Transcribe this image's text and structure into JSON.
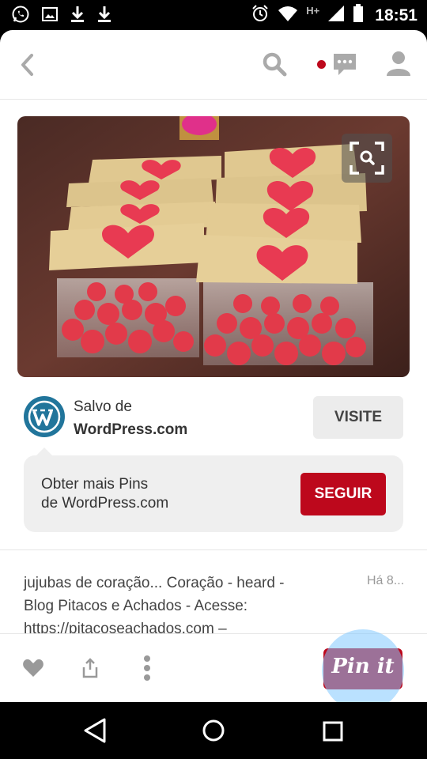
{
  "status_bar": {
    "time": "18:51",
    "network_type": "H+",
    "notification_icons": [
      "whatsapp-icon",
      "image-icon",
      "download-icon",
      "download-icon"
    ],
    "system_icons": [
      "alarm-icon",
      "wifi-icon",
      "signal-icon",
      "battery-icon"
    ]
  },
  "toolbar": {
    "icons": [
      "back-icon",
      "search-icon",
      "messages-icon",
      "profile-icon"
    ],
    "notification_color": "#bd081c"
  },
  "pin": {
    "image_icon": "zoom-expand-icon",
    "source_saved_label": "Salvo de",
    "source_name": "WordPress.com",
    "source_logo_icon": "wordpress-icon",
    "visit_label": "VISITE",
    "follow_line1": "Obter mais Pins",
    "follow_line2": "de WordPress.com",
    "follow_label": "SEGUIR",
    "description_line1": "jujubas de coração... Coração - heard -",
    "description_line2": "Blog Pitacos e Achados -  Acesse:",
    "description_line3": "https://pitacoseachados.com –",
    "time_ago": "Há 8..."
  },
  "actions": {
    "icons": [
      "heart-icon",
      "share-icon",
      "more-icon"
    ],
    "pin_it_label": "Pin it",
    "accent": "#bd081c"
  },
  "nav_bar": {
    "icons": [
      "nav-back-icon",
      "nav-home-icon",
      "nav-recent-icon"
    ]
  }
}
